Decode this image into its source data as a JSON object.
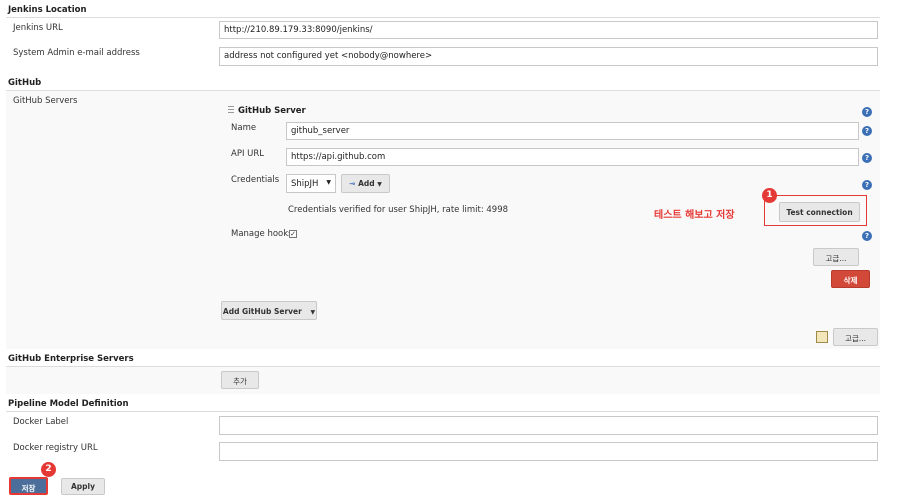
{
  "jenkins_location": {
    "title": "Jenkins Location",
    "url_label": "Jenkins URL",
    "url_value": "http://210.89.179.33:8090/jenkins/",
    "email_label": "System Admin e-mail address",
    "email_value": "address not configured yet <nobody@nowhere>"
  },
  "github": {
    "title": "GitHub",
    "servers_label": "GitHub Servers",
    "server": {
      "header": "GitHub Server",
      "name_label": "Name",
      "name_value": "github_server",
      "api_label": "API URL",
      "api_value": "https://api.github.com",
      "credentials_label": "Credentials",
      "credentials_selected": "ShipJH",
      "add_label": "Add",
      "verified_text": "Credentials verified for user ShipJH, rate limit: 4998",
      "test_button": "Test connection",
      "annotation_text": "테스트 해보고 저장",
      "manage_hooks_label": "Manage hooks",
      "advanced_button": "고급...",
      "delete_button": "삭제"
    },
    "add_server_button": "Add GitHub Server",
    "advanced_button": "고급..."
  },
  "github_enterprise": {
    "title": "GitHub Enterprise Servers",
    "add_button": "추가"
  },
  "pipeline": {
    "title": "Pipeline Model Definition",
    "docker_label": "Docker Label",
    "docker_label_value": "",
    "registry_label": "Docker registry URL",
    "registry_value": ""
  },
  "footer": {
    "save_button": "저장",
    "apply_button": "Apply"
  },
  "badges": {
    "one": "1",
    "two": "2"
  }
}
